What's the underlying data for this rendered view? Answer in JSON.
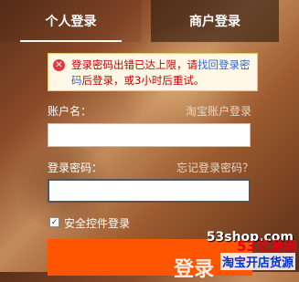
{
  "tabs": {
    "personal_login": "个人登录",
    "merchant_login": "商户登录"
  },
  "error": {
    "text_part1": "登录密码出错已达上限，请",
    "link_text": "找回登录密码",
    "text_part2": "后登录，或3小时后重试。"
  },
  "account": {
    "label": "账户名：",
    "alt_link": "淘宝账户登录",
    "value": ""
  },
  "password": {
    "label": "登录密码：",
    "forgot_link": "忘记登录密码？",
    "value": ""
  },
  "security_checkbox": {
    "label": "安全控件登录",
    "checked": true
  },
  "submit": {
    "label": "登录"
  },
  "watermark": {
    "url": "53shop.com",
    "brand_num": "53",
    "brand_text": "货源网",
    "sub": "淘宝开店货源"
  }
}
